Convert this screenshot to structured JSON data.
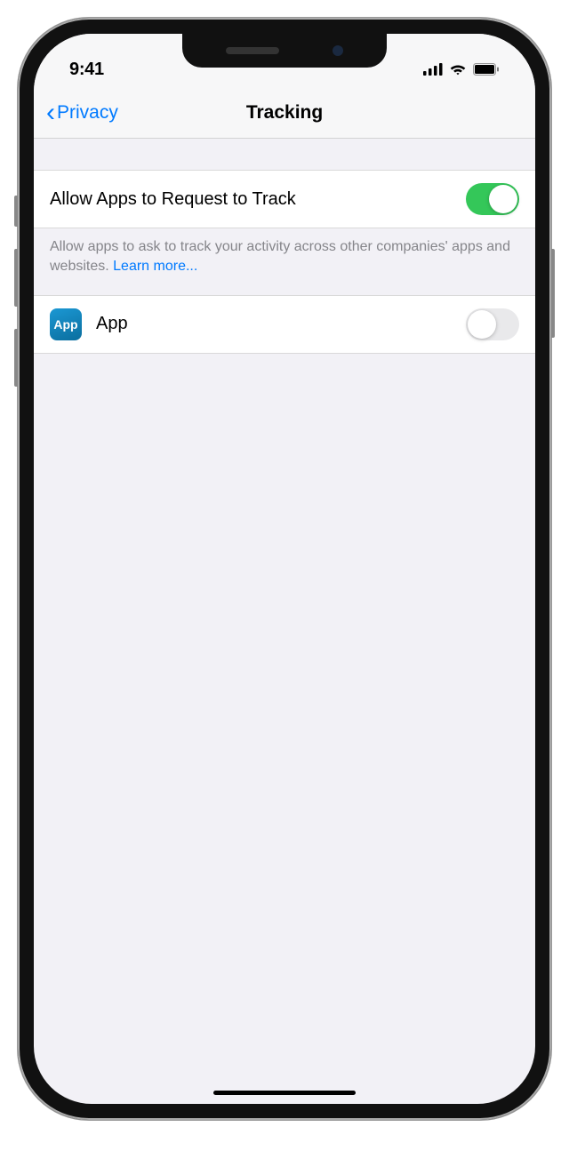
{
  "status_bar": {
    "time": "9:41"
  },
  "nav": {
    "back_label": "Privacy",
    "title": "Tracking"
  },
  "settings": {
    "allow_tracking": {
      "label": "Allow Apps to Request to Track",
      "enabled": true
    },
    "footer_text": "Allow apps to ask to track your activity across other companies' apps and websites. ",
    "learn_more": "Learn more...",
    "apps": [
      {
        "name": "App",
        "icon_text": "App",
        "enabled": false
      }
    ]
  }
}
